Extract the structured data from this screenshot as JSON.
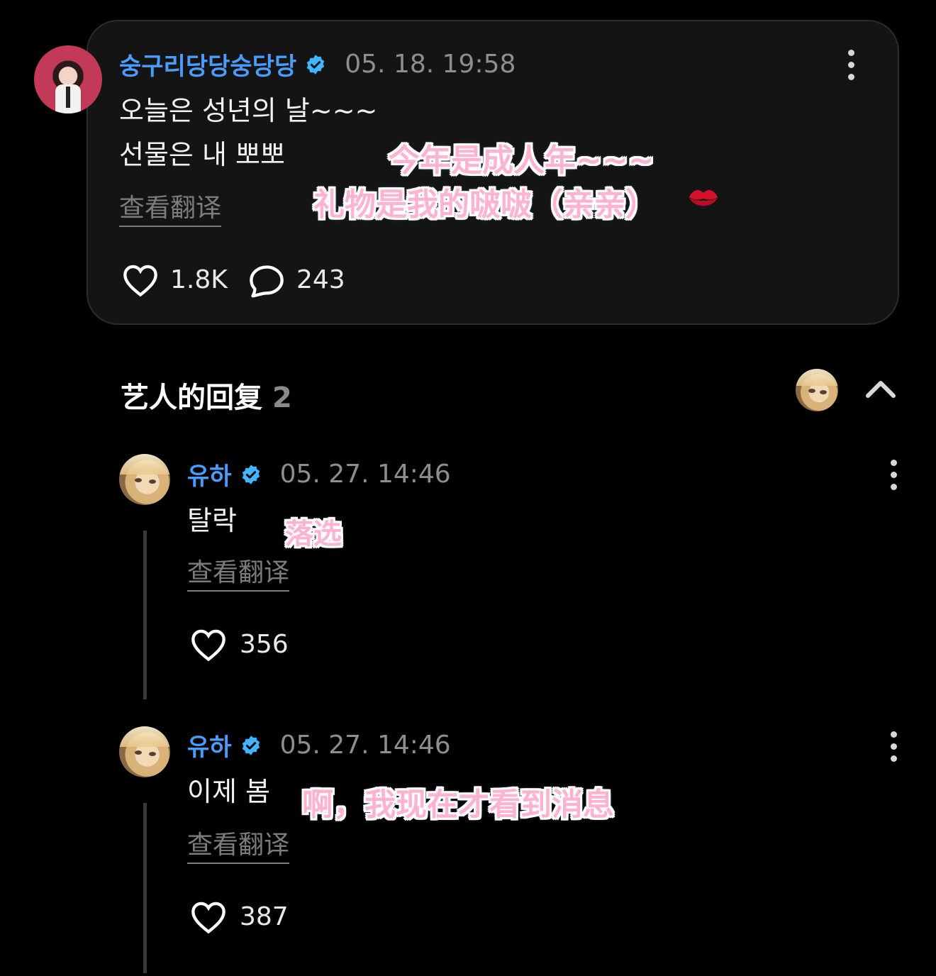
{
  "post": {
    "username": "숭구리당당숭당당",
    "timestamp": "05. 18. 19:58",
    "text_line1": "오늘은 성년의 날~~~",
    "text_line2": "선물은 내 뽀뽀",
    "translate_label": "查看翻译",
    "likes": "1.8K",
    "comments": "243",
    "caption_line1": "今年是成人年~~~",
    "caption_line2": "礼物是我的啵啵（亲亲）",
    "caption_icon": "kiss-lips-icon"
  },
  "replies_section": {
    "title": "艺人的回复",
    "count": "2"
  },
  "replies": [
    {
      "username": "유하",
      "timestamp": "05. 27. 14:46",
      "text": "탈락",
      "caption": "落选",
      "translate_label": "查看翻译",
      "likes": "356"
    },
    {
      "username": "유하",
      "timestamp": "05. 27. 14:46",
      "text": "이제 봄",
      "caption": "啊，我现在才看到消息",
      "translate_label": "查看翻译",
      "likes": "387"
    }
  ],
  "colors": {
    "background": "#000000",
    "card": "#141414",
    "username": "#4a9cff",
    "verified_badge": "#3fb6ff",
    "caption": "#ffb3d1"
  }
}
